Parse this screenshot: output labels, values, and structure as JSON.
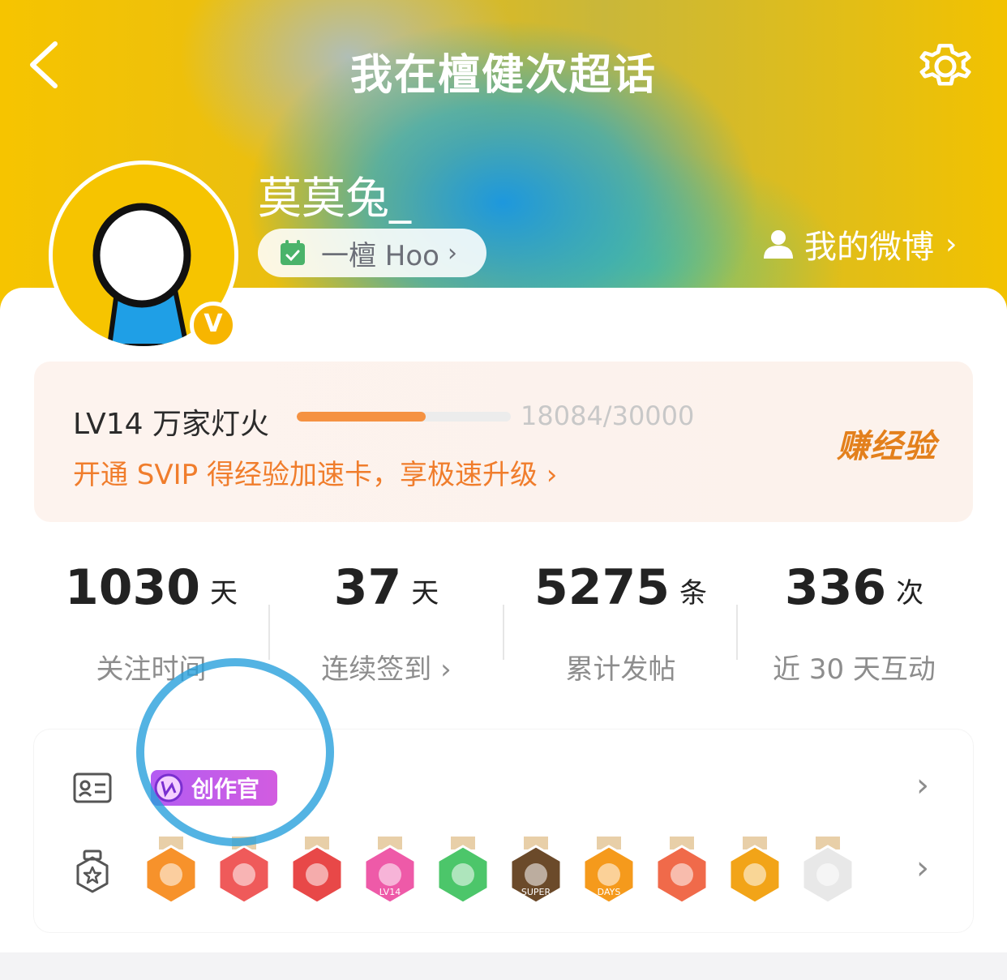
{
  "nav": {
    "title": "我在檀健次超话",
    "back_icon": "back-chevron-icon",
    "settings_icon": "gear-icon"
  },
  "profile": {
    "username": "莫莫兔_",
    "title_pill": "一檀 Hoo",
    "my_weibo": "我的微博",
    "verified_badge": "V",
    "accent_color": "#f6c400"
  },
  "level": {
    "label": "LV14 万家灯火",
    "progress_text": "18084/30000",
    "progress_fraction": 0.6028,
    "promo": "开通 SVIP 得经验加速卡，享极速升级",
    "earn_button": "赚经验",
    "accent_color": "#f07d2c"
  },
  "stats": [
    {
      "value": "1030",
      "unit": "天",
      "label": "关注时间",
      "chevron": ""
    },
    {
      "value": "37",
      "unit": "天",
      "label": "连续签到",
      "chevron": "›"
    },
    {
      "value": "5275",
      "unit": "条",
      "label": "累计发帖",
      "chevron": ""
    },
    {
      "value": "336",
      "unit": "次",
      "label": "近 30 天互动",
      "chevron": ""
    }
  ],
  "honors": {
    "creator_badge": "创作官",
    "medals": [
      {
        "icon": "crown-medal-icon",
        "color": "#f7922b"
      },
      {
        "icon": "trophy-medal-icon",
        "color": "#ef5a5a"
      },
      {
        "icon": "mascot-medal-icon",
        "color": "#e84848"
      },
      {
        "icon": "lv14-medal-icon",
        "color": "#ee5aa8",
        "text": "LV14"
      },
      {
        "icon": "hand-medal-icon",
        "color": "#4cc66a"
      },
      {
        "icon": "super-medal-icon",
        "color": "#6b4a2a",
        "text": "SUPER"
      },
      {
        "icon": "30-days-medal-icon",
        "color": "#f59a1c",
        "text": "DAYS"
      },
      {
        "icon": "rock-hand-medal-icon",
        "color": "#f06a4a"
      },
      {
        "icon": "flame-medal-icon",
        "color": "#f2a418"
      },
      {
        "icon": "owl-medal-icon",
        "color": "#e8e8e8"
      }
    ]
  }
}
